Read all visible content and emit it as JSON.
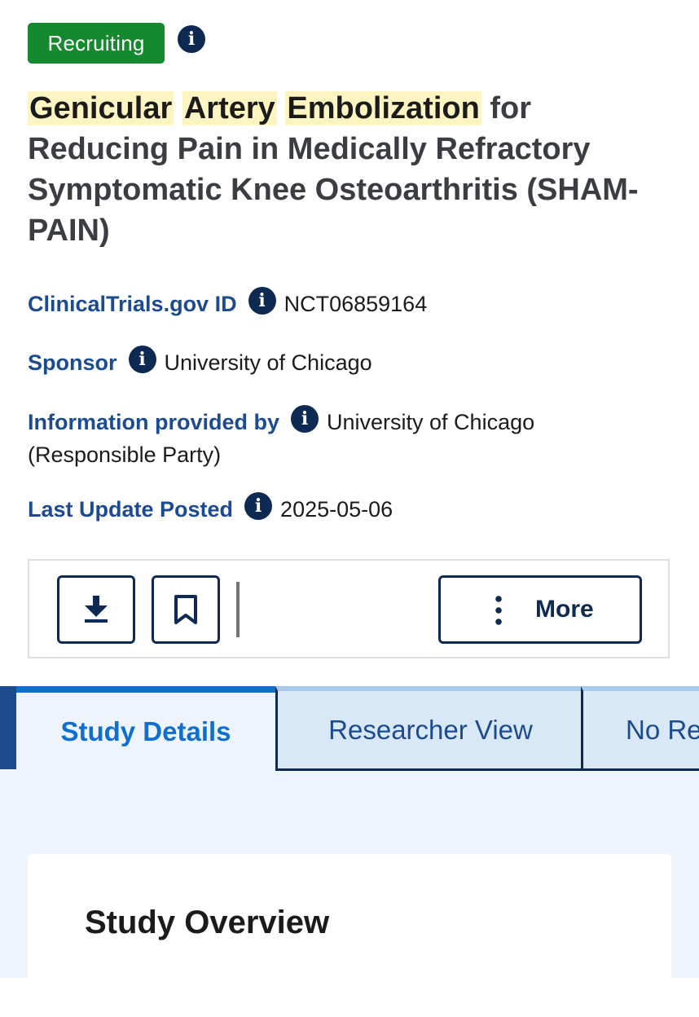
{
  "status": {
    "label": "Recruiting",
    "color": "#14892e",
    "info_icon": "info-icon"
  },
  "study": {
    "title_highlighted": [
      "Genicular",
      "Artery",
      "Embolization"
    ],
    "title_rest_line1": "for",
    "title_rest": "Reducing Pain in Medically Refractory Symptomatic Knee Osteoarthritis (SHAM-PAIN)"
  },
  "meta": {
    "id": {
      "label": "ClinicalTrials.gov ID",
      "value": "NCT06859164"
    },
    "sponsor": {
      "label": "Sponsor",
      "value": "University of Chicago"
    },
    "info_provider": {
      "label": "Information provided by",
      "value": "University of Chicago",
      "value_line2": "(Responsible Party)"
    },
    "last_update": {
      "label": "Last Update Posted",
      "value": "2025-05-06"
    }
  },
  "actions": {
    "download_icon": "download-icon",
    "bookmark_icon": "bookmark-icon",
    "more_label": "More"
  },
  "tabs": [
    {
      "label": "Study Details",
      "active": true
    },
    {
      "label": "Researcher View",
      "active": false
    },
    {
      "label": "No Re",
      "active": false
    }
  ],
  "section": {
    "title": "Study Overview"
  },
  "colors": {
    "accent": "#0f6fd1",
    "navy": "#0e2a52",
    "label_blue": "#1c4b8f",
    "highlight": "#fff5c2"
  }
}
